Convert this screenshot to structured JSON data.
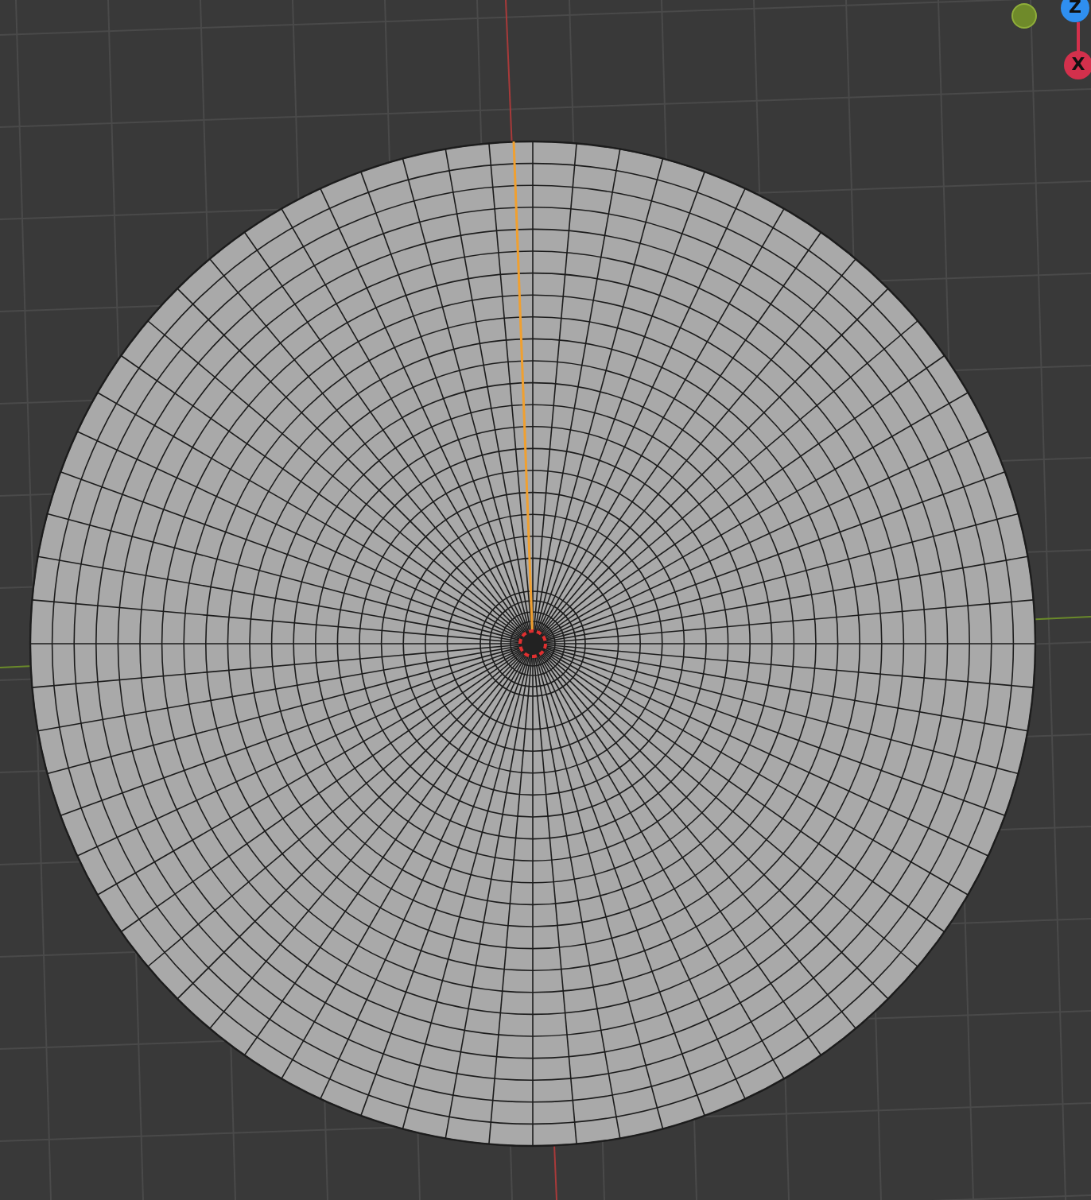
{
  "gizmo": {
    "axes": [
      {
        "label": "Z",
        "color": "#2f8ff0"
      },
      {
        "label": "X",
        "color": "#d4304c"
      }
    ]
  }
}
